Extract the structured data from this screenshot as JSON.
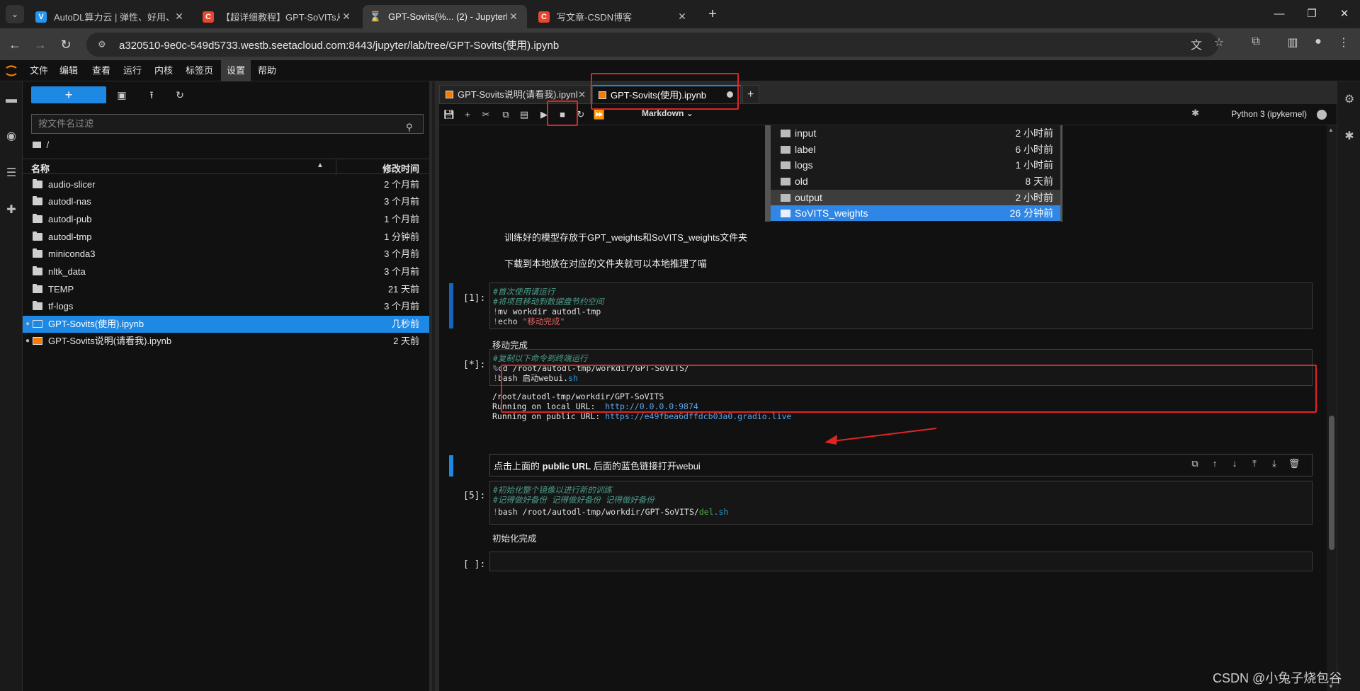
{
  "browser": {
    "tabs": [
      {
        "title": "AutoDL算力云 | 弹性、好用、",
        "icon": "autodl-icon"
      },
      {
        "title": "【超详细教程】GPT-SoVITs从",
        "icon": "csdn-icon"
      },
      {
        "title": "GPT-Sovits(%... (2) - JupyterL",
        "icon": "jupyter-icon"
      },
      {
        "title": "写文章-CSDN博客",
        "icon": "csdn-icon"
      }
    ],
    "url": "a320510-9e0c-549d5733.westb.seetacloud.com:8443/jupyter/lab/tree/GPT-Sovits(使用).ipynb"
  },
  "menubar": [
    "文件",
    "编辑",
    "查看",
    "运行",
    "内核",
    "标签页",
    "设置",
    "帮助"
  ],
  "filebrowser": {
    "filter_placeholder": "按文件名过滤",
    "breadcrumb": "/",
    "col_name": "名称",
    "col_modified": "修改时间",
    "rows": [
      {
        "name": "audio-slicer",
        "time": "2 个月前",
        "type": "folder"
      },
      {
        "name": "autodl-nas",
        "time": "3 个月前",
        "type": "folder"
      },
      {
        "name": "autodl-pub",
        "time": "1 个月前",
        "type": "folder"
      },
      {
        "name": "autodl-tmp",
        "time": "1 分钟前",
        "type": "folder"
      },
      {
        "name": "miniconda3",
        "time": "3 个月前",
        "type": "folder"
      },
      {
        "name": "nltk_data",
        "time": "3 个月前",
        "type": "folder"
      },
      {
        "name": "TEMP",
        "time": "21 天前",
        "type": "folder"
      },
      {
        "name": "tf-logs",
        "time": "3 个月前",
        "type": "folder"
      },
      {
        "name": "GPT-Sovits(使用).ipynb",
        "time": "几秒前",
        "type": "notebook"
      },
      {
        "name": "GPT-Sovits说明(请看我).ipynb",
        "time": "2 天前",
        "type": "notebook"
      }
    ]
  },
  "notebook": {
    "tabs": [
      {
        "title": "GPT-Sovits说明(请看我).ipynl"
      },
      {
        "title": "GPT-Sovits(使用).ipynb"
      }
    ],
    "cell_type": "Markdown",
    "kernel": "Python 3 (ipykernel)",
    "embedded_files": [
      {
        "name": "input",
        "time": "2 小时前"
      },
      {
        "name": "label",
        "time": "6 小时前"
      },
      {
        "name": "logs",
        "time": "1 小时前"
      },
      {
        "name": "old",
        "time": "8 天前"
      },
      {
        "name": "output",
        "time": "2 小时前"
      },
      {
        "name": "SoVITS_weights",
        "time": "26 分钟前"
      }
    ],
    "md1": "训练好的模型存放于GPT_weights和SoVITS_weights文件夹",
    "md2": "下载到本地放在对应的文件夹就可以本地推理了喵",
    "cell1": {
      "prompt": "[1]:",
      "c1": "#首次使用请运行",
      "c2": "#将项目移动到数据盘节约空间",
      "bang1": "!",
      "l3": "mv workdir autodl-tmp",
      "bang2": "!",
      "l4a": "echo ",
      "l4b": "\"移动完成\"",
      "output": "移动完成"
    },
    "cell2": {
      "prompt": "[*]:",
      "c1": "#复制以下命令到终端运行",
      "op": "%",
      "l2": "cd /root/autodl-tmp/workdir/GPT-SoVITS/",
      "bang": "!",
      "l3a": "bash 启动webui.",
      "l3b": "sh",
      "out1": "/root/autodl-tmp/workdir/GPT-SoVITS",
      "out2a": "Running on local URL:  ",
      "out2b": "http://0.0.0.0:9874",
      "out3a": "Running on public URL: ",
      "out3b": "https://e49fbea6dffdcb03a0.gradio.live"
    },
    "md3_a": "点击上面的 ",
    "md3_b": "public URL",
    "md3_c": " 后面的蓝色链接打开webui",
    "cell5": {
      "prompt": "[5]:",
      "c1": "#初始化整个镜像以进行新的训练",
      "c2": "#记得做好备份 记得做好备份 记得做好备份",
      "bang": "!",
      "l3a": "bash /root/autodl-tmp/workdir/GPT-SoVITS/",
      "l3b": "del",
      "l3c": ".sh",
      "output": "初始化完成"
    },
    "cell_empty": {
      "prompt": "[ ]:"
    }
  },
  "watermark": "CSDN @小兔子烧包谷",
  "colors": {
    "accent": "#1e88e5",
    "annotation": "#e02424",
    "orange": "#f57c00"
  }
}
